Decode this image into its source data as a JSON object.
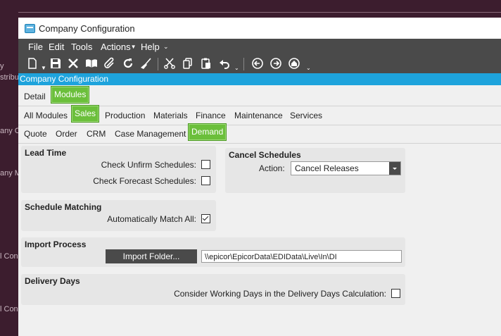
{
  "background": {
    "fragments": [
      "y",
      "stribu",
      "any C",
      "any M",
      "l Con",
      "l Con"
    ]
  },
  "window": {
    "title": "Company Configuration"
  },
  "menu": {
    "items": [
      "File",
      "Edit",
      "Tools",
      "Actions",
      "Help"
    ]
  },
  "app_bar": {
    "title": "Company Configuration"
  },
  "tabs": {
    "top": [
      "Detail",
      "Modules"
    ],
    "modules": [
      "All Modules",
      "Sales",
      "Production",
      "Materials",
      "Finance",
      "Maintenance",
      "Services"
    ],
    "sales": [
      "Quote",
      "Order",
      "CRM",
      "Case Management",
      "Demand"
    ]
  },
  "lead_time": {
    "title": "Lead Time",
    "check_unfirm_label": "Check Unfirm Schedules:",
    "check_unfirm_checked": false,
    "check_forecast_label": "Check Forecast Schedules:",
    "check_forecast_checked": false
  },
  "cancel_schedules": {
    "title": "Cancel Schedules",
    "action_label": "Action:",
    "action_value": "Cancel Releases"
  },
  "schedule_matching": {
    "title": "Schedule Matching",
    "auto_match_label": "Automatically Match All:",
    "auto_match_checked": true
  },
  "import_process": {
    "title": "Import Process",
    "import_button": "Import Folder...",
    "folder_value": "\\\\epicor\\EpicorData\\EDIData\\Live\\In\\DI"
  },
  "delivery_days": {
    "title": "Delivery Days",
    "working_days_label": "Consider Working Days in the Delivery Days Calculation:",
    "working_days_checked": false
  },
  "colors": {
    "accent_green": "#6bbf3b",
    "app_bar_blue": "#1ea3dc",
    "menu_dark": "#4a4a4a"
  }
}
